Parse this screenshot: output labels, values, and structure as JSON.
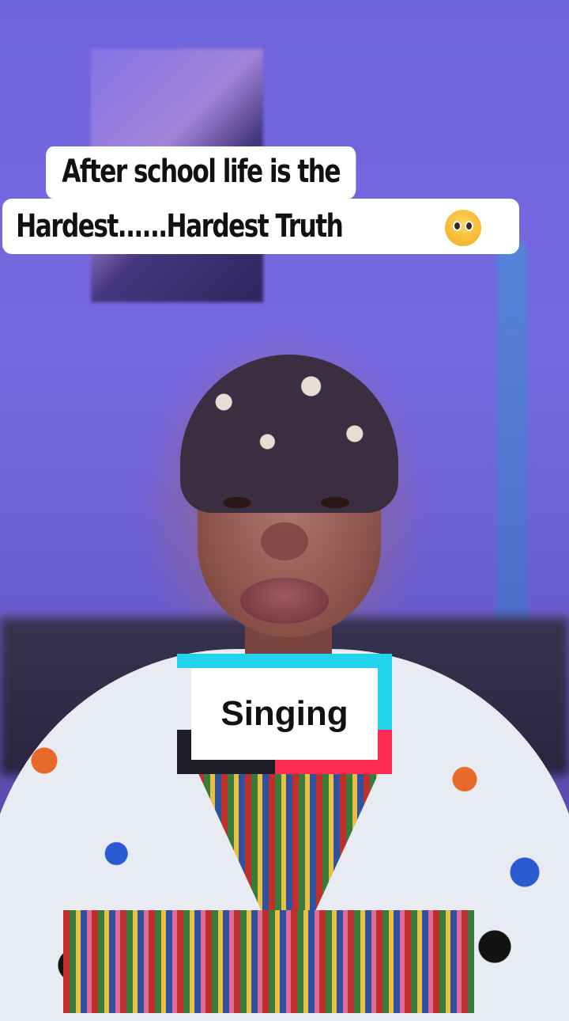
{
  "caption": {
    "line1": "After school life is the",
    "line2": "Hardest......Hardest Truth",
    "emoji": "🥹"
  },
  "tag": {
    "label": "Singing",
    "colors": {
      "cyan": "#22d3ee",
      "pink": "#fe2c55",
      "dark": "#1e1e2a"
    }
  }
}
